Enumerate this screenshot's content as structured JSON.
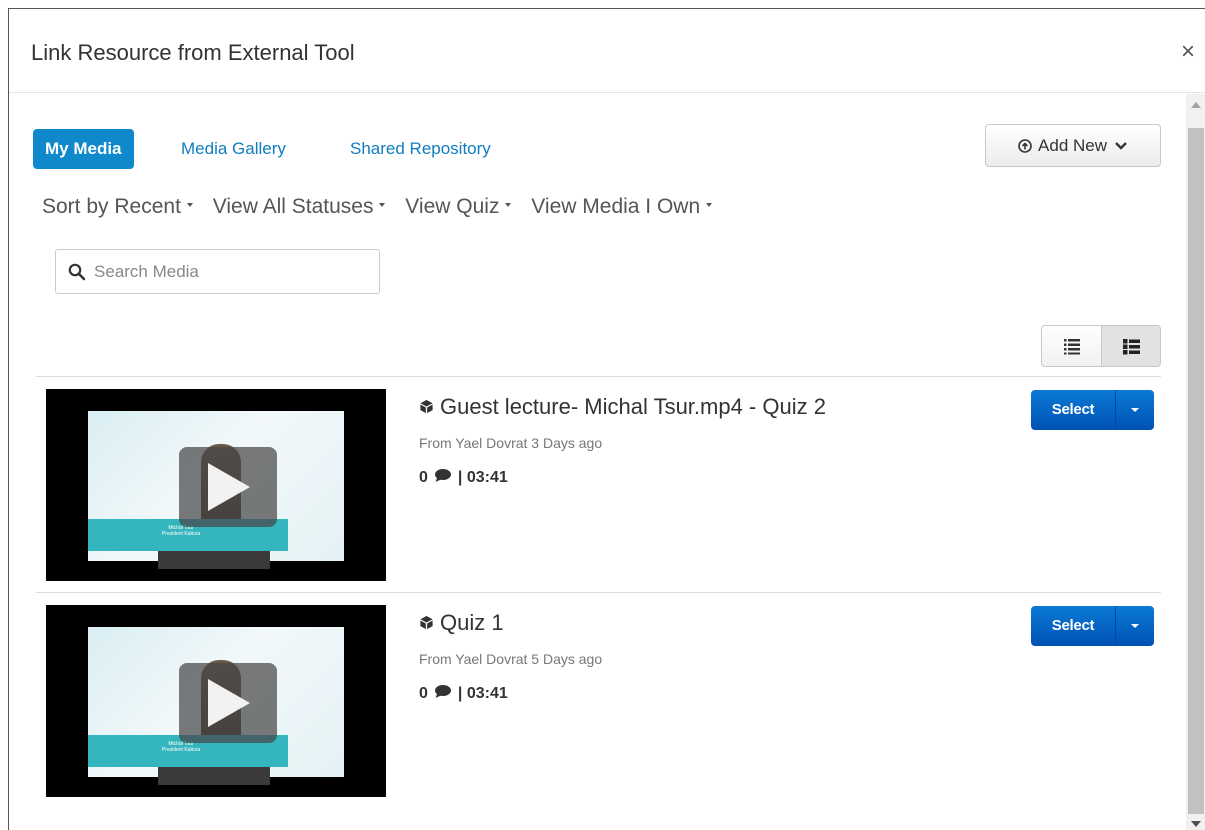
{
  "modal": {
    "title": "Link Resource from External Tool",
    "close_label": "×"
  },
  "tabs": [
    {
      "label": "My Media",
      "active": true
    },
    {
      "label": "Media Gallery",
      "active": false
    },
    {
      "label": "Shared Repository",
      "active": false
    }
  ],
  "add_new": {
    "label": "Add New",
    "icon": "upload-circle-icon"
  },
  "filters": [
    {
      "label": "Sort by Recent"
    },
    {
      "label": "View All Statuses"
    },
    {
      "label": "View Quiz"
    },
    {
      "label": "View Media I Own"
    }
  ],
  "search": {
    "placeholder": "Search Media",
    "value": ""
  },
  "view_toggle": {
    "options": [
      "list-view-icon",
      "detailed-view-icon"
    ],
    "selected": "detailed-view-icon"
  },
  "media": [
    {
      "title": "Guest lecture- Michal Tsur.mp4 - Quiz 2",
      "owner": "From Yael Dovrat 3 Days ago",
      "comments": "0",
      "duration": "| 03:41",
      "select_label": "Select",
      "thumbnail_text": "Michal Tsur President Kaltura"
    },
    {
      "title": "Quiz 1",
      "owner": "From Yael Dovrat 5 Days ago",
      "comments": "0",
      "duration": "| 03:41",
      "select_label": "Select",
      "thumbnail_text": "Michal Tsur President Kaltura"
    }
  ],
  "colors": {
    "accent": "#0f88cc",
    "link": "#0f7dc0",
    "select_button": "#0062c4"
  }
}
